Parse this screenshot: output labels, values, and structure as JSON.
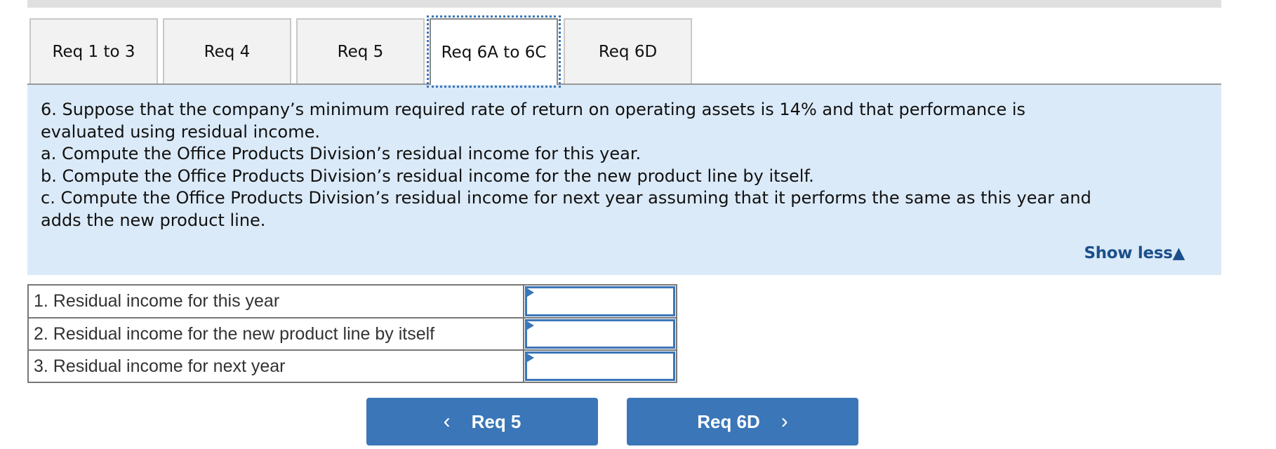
{
  "tabs": [
    {
      "label": "Req 1 to 3",
      "active": false
    },
    {
      "label": "Req 4",
      "active": false
    },
    {
      "label": "Req 5",
      "active": false
    },
    {
      "label": "Req 6A to 6C",
      "active": true
    },
    {
      "label": "Req 6D",
      "active": false
    }
  ],
  "prompt": {
    "lines": [
      "6. Suppose that the company’s minimum required rate of return on operating assets is 14% and that performance is",
      "evaluated using residual income.",
      "a. Compute the Office Products Division’s residual income for this year.",
      "b. Compute the Office Products Division’s residual income for the new product line by itself.",
      "c. Compute the Office Products Division’s residual income for next year assuming that it performs the same as this year and",
      "adds the new product line."
    ],
    "show_less_label": "Show less",
    "show_less_icon": "▲"
  },
  "answer_table": {
    "rows": [
      {
        "label": "1. Residual income for this year",
        "value": ""
      },
      {
        "label": "2. Residual income for the new product line by itself",
        "value": ""
      },
      {
        "label": "3. Residual income for next year",
        "value": ""
      }
    ]
  },
  "navigation": {
    "prev": {
      "label": "Req 5",
      "icon": "‹"
    },
    "next": {
      "label": "Req 6D",
      "icon": "›"
    }
  },
  "colors": {
    "accent": "#3a76b8",
    "panel_bg": "#dbeaf8",
    "link": "#1b4f8a"
  }
}
